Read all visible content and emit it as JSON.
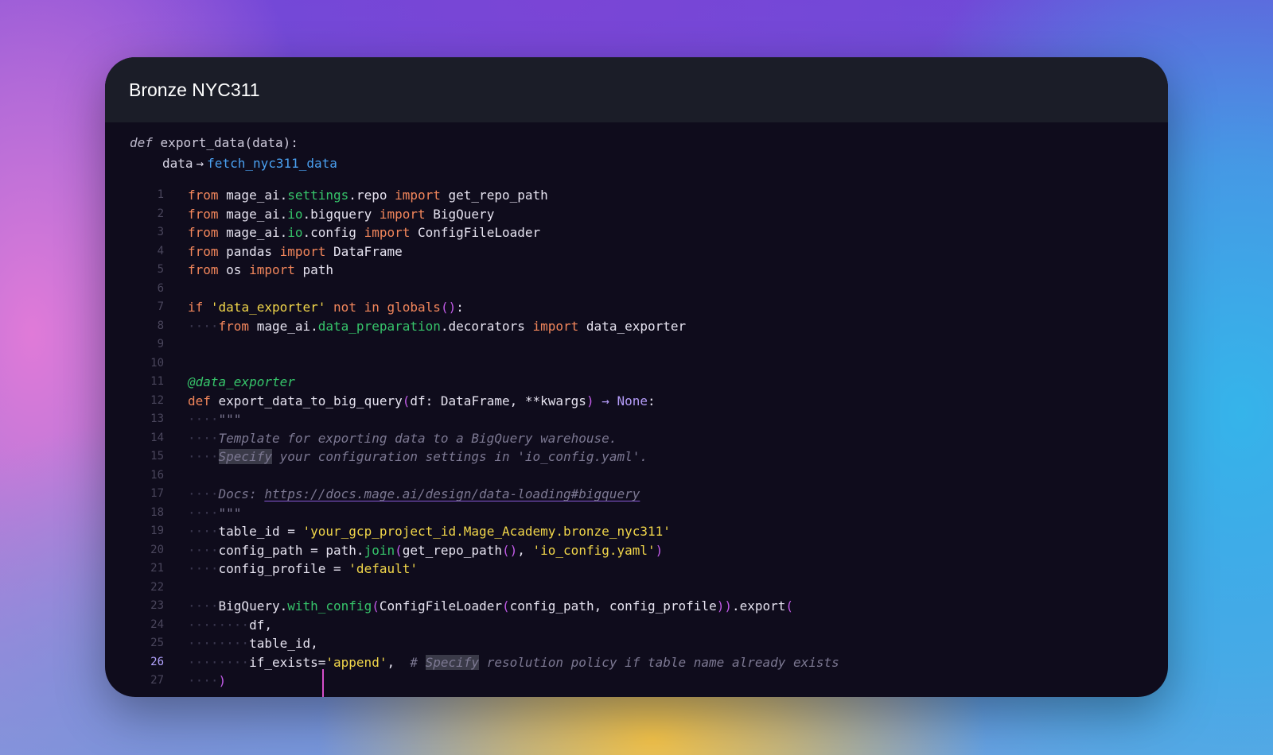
{
  "window": {
    "title": "Bronze NYC311"
  },
  "block": {
    "signature_kw": "def",
    "signature": "export_data(data):",
    "upstream_param": "data",
    "upstream_arrow": "→",
    "upstream_block": "fetch_nyc311_data"
  },
  "editor": {
    "active_line": 26,
    "line_numbers": [
      "1",
      "2",
      "3",
      "4",
      "5",
      "6",
      "7",
      "8",
      "9",
      "10",
      "11",
      "12",
      "13",
      "14",
      "15",
      "16",
      "17",
      "18",
      "19",
      "20",
      "21",
      "22",
      "23",
      "24",
      "25",
      "26",
      "27"
    ],
    "lines": [
      "from mage_ai.settings.repo import get_repo_path",
      "from mage_ai.io.bigquery import BigQuery",
      "from mage_ai.io.config import ConfigFileLoader",
      "from pandas import DataFrame",
      "from os import path",
      "",
      "if 'data_exporter' not in globals():",
      "    from mage_ai.data_preparation.decorators import data_exporter",
      "",
      "",
      "@data_exporter",
      "def export_data_to_big_query(df: DataFrame, **kwargs) -> None:",
      "    \"\"\"",
      "    Template for exporting data to a BigQuery warehouse.",
      "    Specify your configuration settings in 'io_config.yaml'.",
      "",
      "    Docs: https://docs.mage.ai/design/data-loading#bigquery",
      "    \"\"\"",
      "    table_id = 'your_gcp_project_id.Mage_Academy.bronze_nyc311'",
      "    config_path = path.join(get_repo_path(), 'io_config.yaml')",
      "    config_profile = 'default'",
      "",
      "    BigQuery.with_config(ConfigFileLoader(config_path, config_profile)).export(",
      "        df,",
      "        table_id,",
      "        if_exists='append',  # Specify resolution policy if table name already exists",
      "    )"
    ]
  },
  "colors": {
    "keyword": "#f2865b",
    "module": "#36c46a",
    "string": "#f1d64a",
    "comment": "#7c7892",
    "link": "#4aa0f0",
    "paren": "#c25be8"
  }
}
